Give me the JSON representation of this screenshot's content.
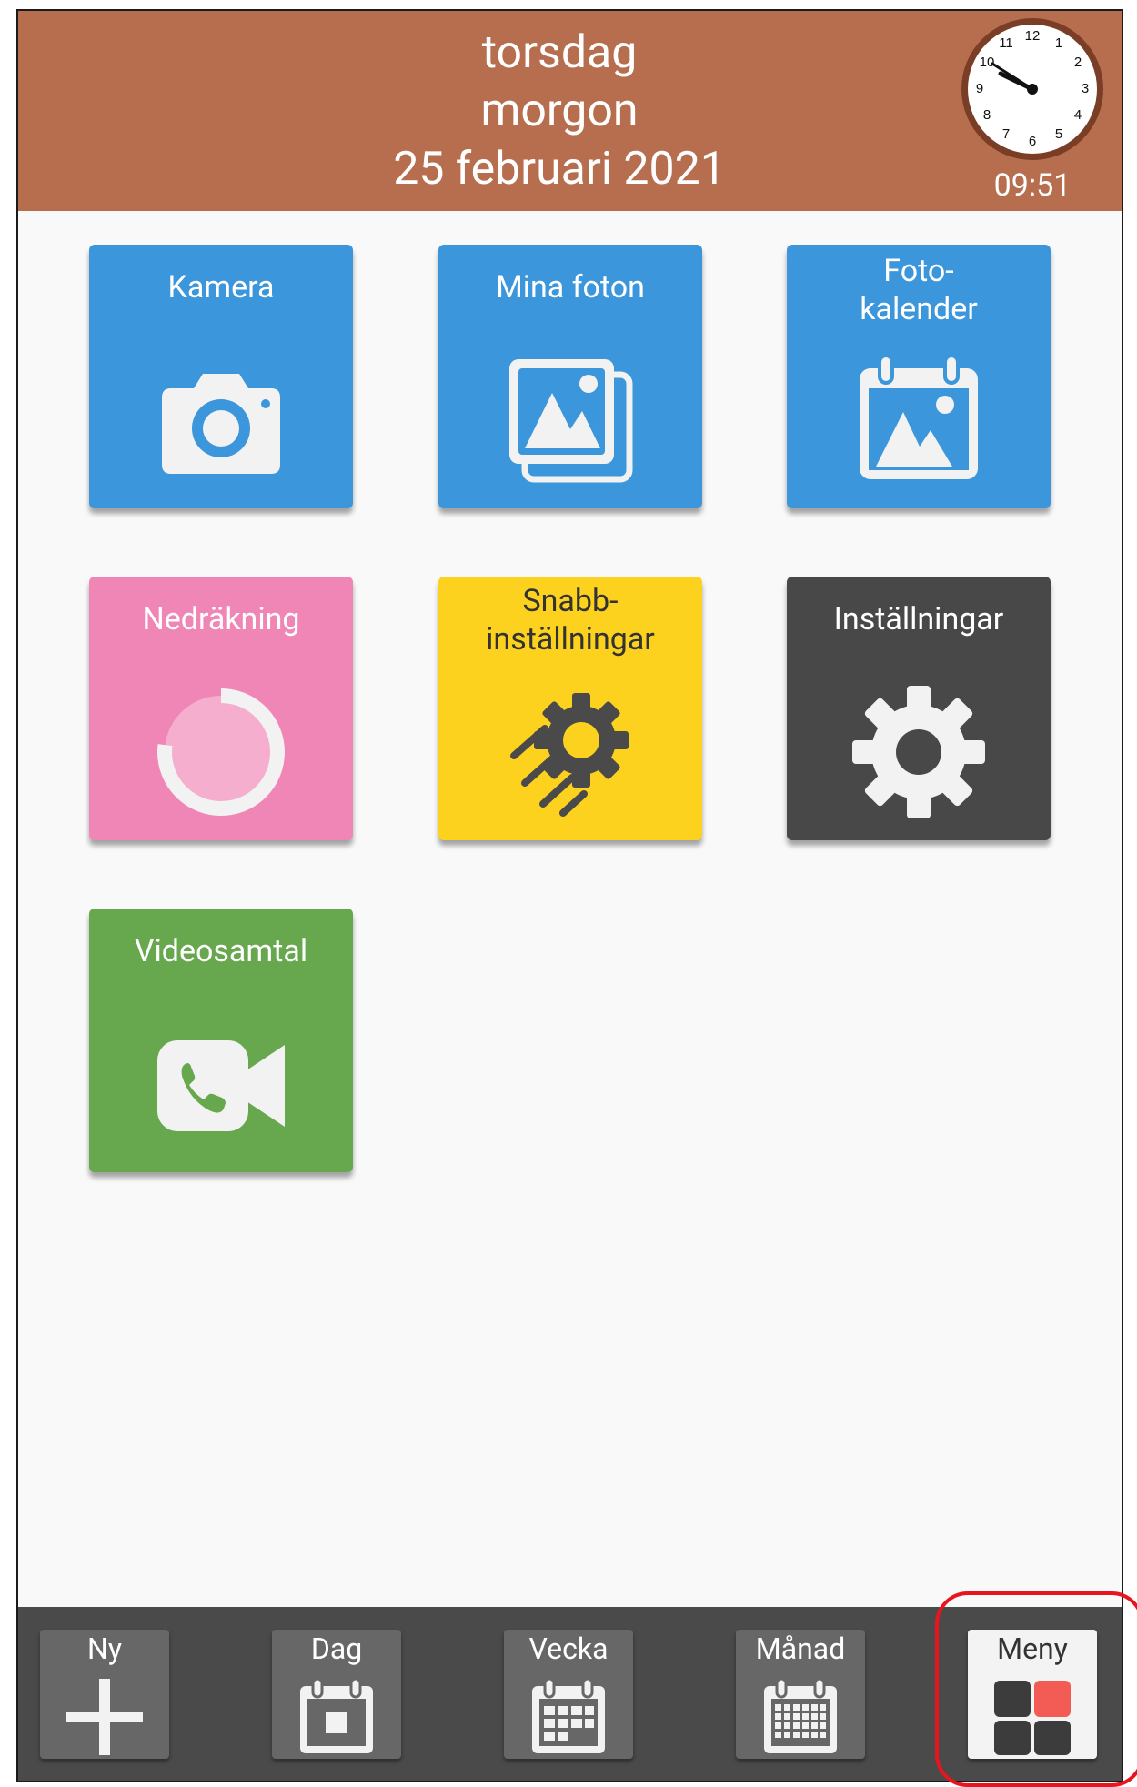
{
  "header": {
    "day": "torsdag",
    "period": "morgon",
    "date": "25 februari 2021",
    "clock_time": "09:51",
    "clock_numbers": [
      "12",
      "1",
      "2",
      "3",
      "4",
      "5",
      "6",
      "7",
      "8",
      "9",
      "10",
      "11"
    ],
    "background_color": "#b66e4f"
  },
  "tiles": {
    "kamera": {
      "label": "Kamera",
      "color": "#3b96db",
      "icon": "camera-icon"
    },
    "mina_foton": {
      "label": "Mina foton",
      "color": "#3b96db",
      "icon": "photos-icon"
    },
    "foto_kalender": {
      "label_line1": "Foto-",
      "label_line2": "kalender",
      "color": "#3b96db",
      "icon": "photo-calendar-icon"
    },
    "nedrakning": {
      "label": "Nedräkning",
      "color": "#ef86b6",
      "icon": "countdown-icon"
    },
    "snabb": {
      "label_line1": "Snabb-",
      "label_line2": "inställningar",
      "color": "#fcd21f",
      "icon": "quick-settings-gear-icon"
    },
    "installningar": {
      "label": "Inställningar",
      "color": "#484848",
      "icon": "gear-icon"
    },
    "videosamtal": {
      "label": "Videosamtal",
      "color": "#67a84f",
      "icon": "video-call-icon"
    }
  },
  "bottom_nav": {
    "ny": "Ny",
    "dag": "Dag",
    "vecka": "Vecka",
    "manad": "Månad",
    "meny": "Meny"
  }
}
